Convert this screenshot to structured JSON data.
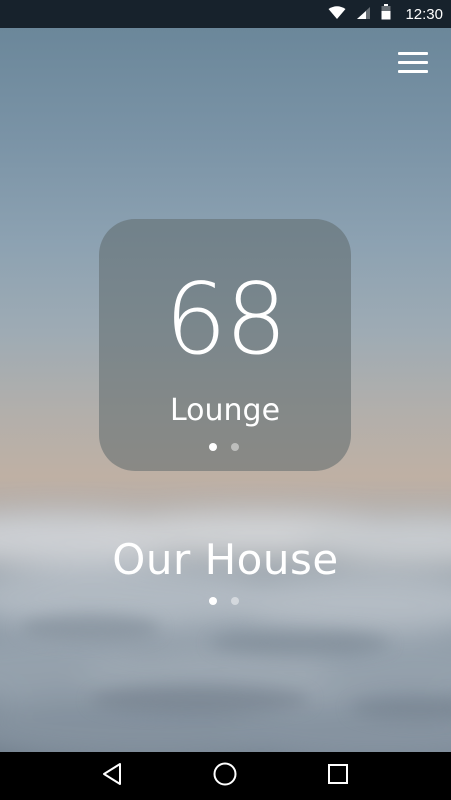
{
  "status_bar": {
    "time": "12:30",
    "icons": [
      "wifi-icon",
      "signal-icon",
      "battery-icon"
    ]
  },
  "header": {
    "menu_icon": "hamburger-menu-icon"
  },
  "thermostat": {
    "temperature": "68",
    "room": "Lounge",
    "room_page_count": 2,
    "room_page_active": 1
  },
  "house": {
    "name": "Our House",
    "page_count": 2,
    "page_active": 1
  },
  "nav_bar": {
    "icons": [
      "back-icon",
      "home-icon",
      "recents-icon"
    ]
  },
  "colors": {
    "status_bar_bg": "#17222c",
    "text": "#ffffff",
    "card_bg": "rgba(95,105,108,0.55)"
  }
}
